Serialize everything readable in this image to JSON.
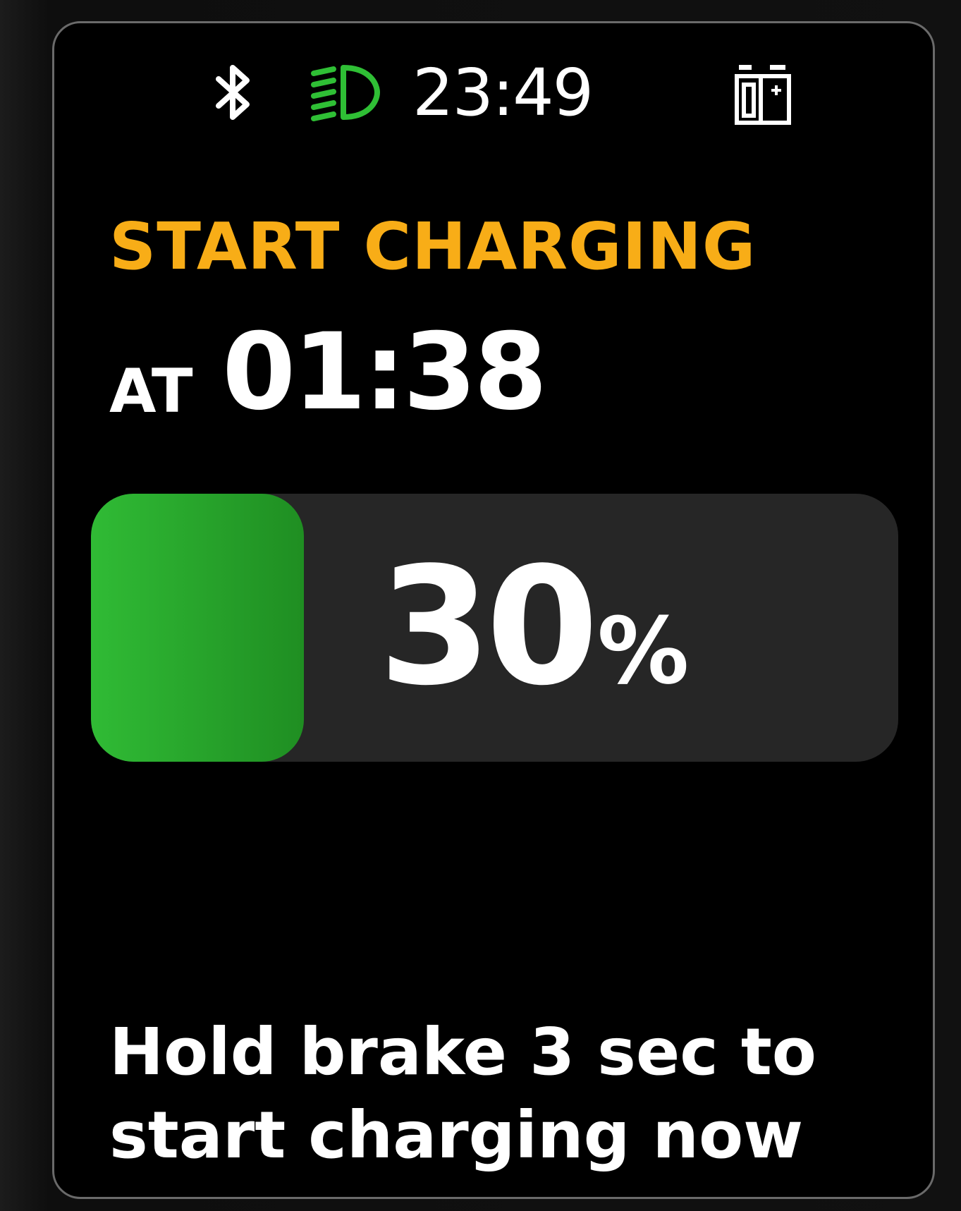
{
  "status_bar": {
    "bluetooth_icon": "bluetooth-icon",
    "headlight_icon": "headlight-icon",
    "headlight_color": "#2fbf35",
    "time": "23:49",
    "battery_icon": "battery-charging-icon"
  },
  "charge_schedule": {
    "headline": "START CHARGING",
    "at_label": "AT",
    "start_time": "01:38",
    "headline_color": "#f8ad17"
  },
  "battery": {
    "level_percent": 30,
    "level_number": "30",
    "percent_sign": "%",
    "fill_color": "#2fb733"
  },
  "hint": {
    "line1": "Hold brake 3 sec to",
    "line2": "start charging now"
  }
}
